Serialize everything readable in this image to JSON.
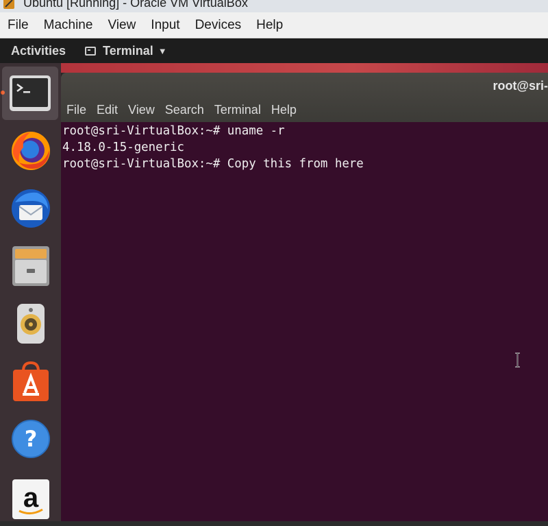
{
  "host": {
    "title": "Ubuntu [Running] - Oracle VM VirtualBox",
    "menu": [
      "File",
      "Machine",
      "View",
      "Input",
      "Devices",
      "Help"
    ]
  },
  "panel": {
    "activities": "Activities",
    "app_name": "Terminal"
  },
  "dock": {
    "items": [
      "terminal-icon",
      "firefox-icon",
      "thunderbird-icon",
      "files-icon",
      "rhythmbox-icon",
      "software-icon",
      "help-icon",
      "amazon-icon"
    ]
  },
  "terminal": {
    "title": "root@sri-",
    "menu": [
      "File",
      "Edit",
      "View",
      "Search",
      "Terminal",
      "Help"
    ],
    "lines": [
      "root@sri-VirtualBox:~# uname -r",
      "4.18.0-15-generic",
      "root@sri-VirtualBox:~# Copy this from here"
    ]
  },
  "colors": {
    "terminal_bg": "#360d2a",
    "ubuntu_orange": "#e95420",
    "panel_bg": "#1d1d1d",
    "dock_bg": "#3b3034"
  }
}
